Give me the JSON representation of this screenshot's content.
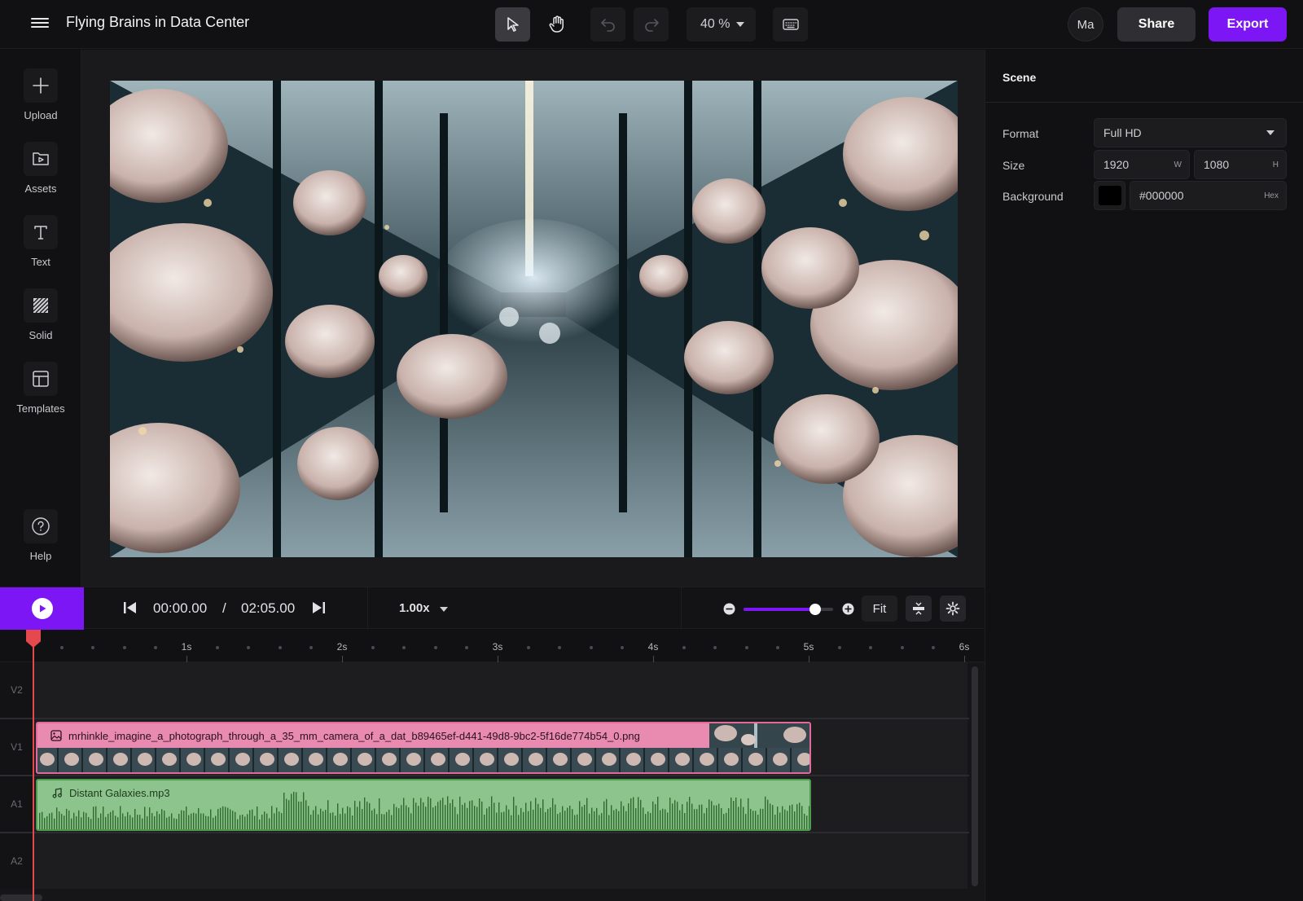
{
  "app": {
    "title": "Flying Brains in Data Center"
  },
  "toolbar": {
    "zoom_value": "40 %",
    "icons": [
      "select-pointer-icon",
      "hand-pan-icon",
      "undo-icon",
      "redo-icon",
      "keyboard-icon"
    ]
  },
  "header_actions": {
    "avatar_initials": "Ma",
    "share_label": "Share",
    "export_label": "Export"
  },
  "sidebar": {
    "items": [
      {
        "label": "Upload",
        "icon": "plus-icon"
      },
      {
        "label": "Assets",
        "icon": "folder-play-icon"
      },
      {
        "label": "Text",
        "icon": "text-icon"
      },
      {
        "label": "Solid",
        "icon": "hatched-square-icon"
      },
      {
        "label": "Templates",
        "icon": "layout-icon"
      }
    ],
    "help_label": "Help"
  },
  "scene_panel": {
    "title": "Scene",
    "format_label": "Format",
    "format_value": "Full HD",
    "size_label": "Size",
    "width_value": "1920",
    "width_suffix": "W",
    "height_value": "1080",
    "height_suffix": "H",
    "background_label": "Background",
    "background_hex": "#000000",
    "background_suffix": "Hex"
  },
  "playback": {
    "current_time": "00:00.00",
    "separator": "/",
    "total_time": "02:05.00",
    "speed": "1.00x",
    "fit_label": "Fit",
    "zoom_slider_level": 0.8
  },
  "ruler": {
    "labels": [
      "1s",
      "2s",
      "3s",
      "4s",
      "5s",
      "6s"
    ]
  },
  "tracks": [
    {
      "label": "V2"
    },
    {
      "label": "V1",
      "clip_name": "mrhinkle_imagine_a_photograph_through_a_35_mm_camera_of_a_dat_b89465ef-d441-49d8-9bc2-5f16de774b54_0.png"
    },
    {
      "label": "A1",
      "clip_name": "Distant Galaxies.mp3"
    },
    {
      "label": "A2"
    }
  ],
  "colors": {
    "accent": "#7c16f5",
    "image_clip": "#e98bb0",
    "audio_clip": "#8dc48d",
    "playhead": "#e5484d"
  }
}
